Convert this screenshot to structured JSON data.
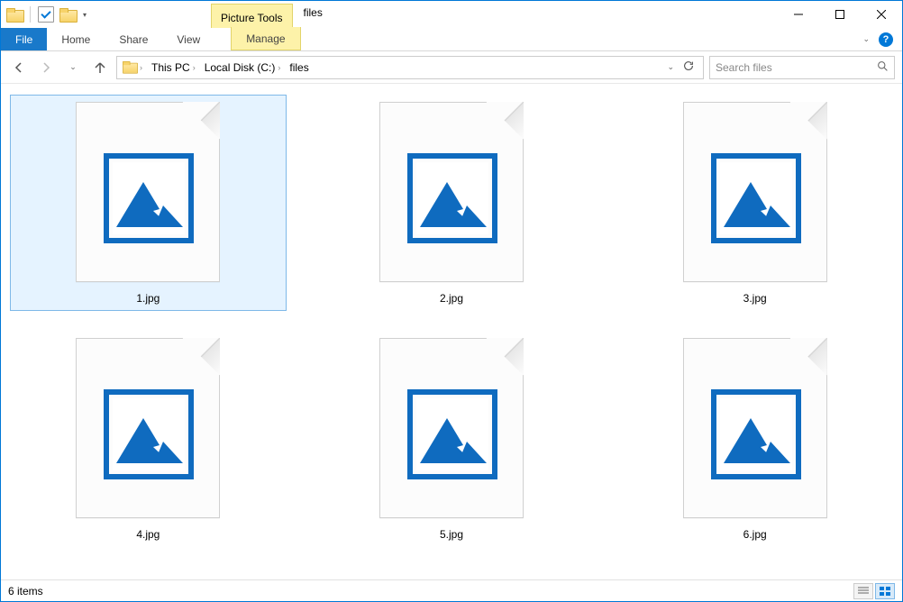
{
  "titlebar": {
    "tools_tab": "Picture Tools",
    "title": "files"
  },
  "ribbon": {
    "file": "File",
    "tabs": [
      "Home",
      "Share",
      "View"
    ],
    "manage": "Manage"
  },
  "breadcrumb": {
    "root_icon": "folder",
    "segments": [
      "This PC",
      "Local Disk (C:)",
      "files"
    ]
  },
  "search": {
    "placeholder": "Search files"
  },
  "files": [
    {
      "name": "1.jpg",
      "selected": true
    },
    {
      "name": "2.jpg",
      "selected": false
    },
    {
      "name": "3.jpg",
      "selected": false
    },
    {
      "name": "4.jpg",
      "selected": false
    },
    {
      "name": "5.jpg",
      "selected": false
    },
    {
      "name": "6.jpg",
      "selected": false
    }
  ],
  "status": {
    "count": "6 items"
  }
}
